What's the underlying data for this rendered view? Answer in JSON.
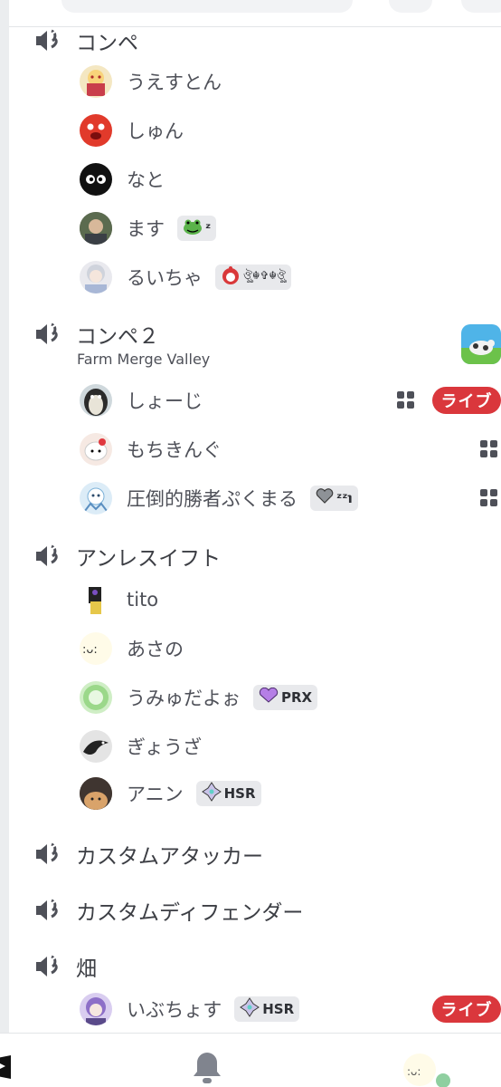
{
  "channels": [
    {
      "name": "コンペ",
      "members": [
        {
          "name": "うえすとん",
          "avatar": "anime-avatar"
        },
        {
          "name": "しゅん",
          "avatar": "red-face-avatar"
        },
        {
          "name": "なと",
          "avatar": "black-soot-avatar"
        },
        {
          "name": "ます",
          "avatar": "photo-avatar",
          "badge": {
            "icon": "frog-icon",
            "text": "ᶻ"
          }
        },
        {
          "name": "るいちゃ",
          "avatar": "grey-hair-avatar",
          "badge": {
            "icon": "red-bell-icon",
            "text": "ঔৣ☬✞☬ঔৣ"
          }
        }
      ]
    },
    {
      "name": "コンペ２",
      "activity": "Farm Merge Valley",
      "activity_icon": "farm-merge-valley-icon",
      "members": [
        {
          "name": "しょーじ",
          "avatar": "penguin-avatar",
          "activity_icon": "controller-icon",
          "live": "ライブ"
        },
        {
          "name": "もちきんぐ",
          "avatar": "hello-kitty-avatar",
          "activity_icon": "controller-icon"
        },
        {
          "name": "圧倒的勝者ぷくまる",
          "avatar": "blue-character-avatar",
          "activity_icon": "controller-icon",
          "badge": {
            "icon": "grey-heart-icon",
            "text": "ᶻᶻ℩"
          }
        }
      ]
    },
    {
      "name": "アンレスイフト",
      "members": [
        {
          "name": "tito",
          "avatar": "dark-figure-avatar"
        },
        {
          "name": "あさの",
          "avatar": "cat-face-avatar"
        },
        {
          "name": "うみゅだよぉ",
          "avatar": "green-avatar",
          "badge": {
            "icon": "purple-heart-icon",
            "text": "PRX"
          }
        },
        {
          "name": "ぎょうざ",
          "avatar": "bird-avatar"
        },
        {
          "name": "アニン",
          "avatar": "cat-photo-avatar",
          "badge": {
            "icon": "hsr-diamond-icon",
            "text": "HSR"
          }
        }
      ]
    },
    {
      "name": "カスタムアタッカー",
      "members": []
    },
    {
      "name": "カスタムディフェンダー",
      "members": []
    },
    {
      "name": "畑",
      "members": [
        {
          "name": "いぶちょす",
          "avatar": "purple-hair-avatar",
          "live": "ライブ",
          "badge": {
            "icon": "hsr-diamond-icon",
            "text": "HSR"
          }
        }
      ]
    }
  ],
  "bottom_nav": [
    {
      "icon": "partial-logo-icon"
    },
    {
      "icon": "bell-icon"
    },
    {
      "icon": "profile-avatar-icon",
      "status": "online"
    }
  ],
  "colors": {
    "live_red": "#da373c",
    "online_green": "#3ba55c",
    "text": "#4e5058"
  }
}
